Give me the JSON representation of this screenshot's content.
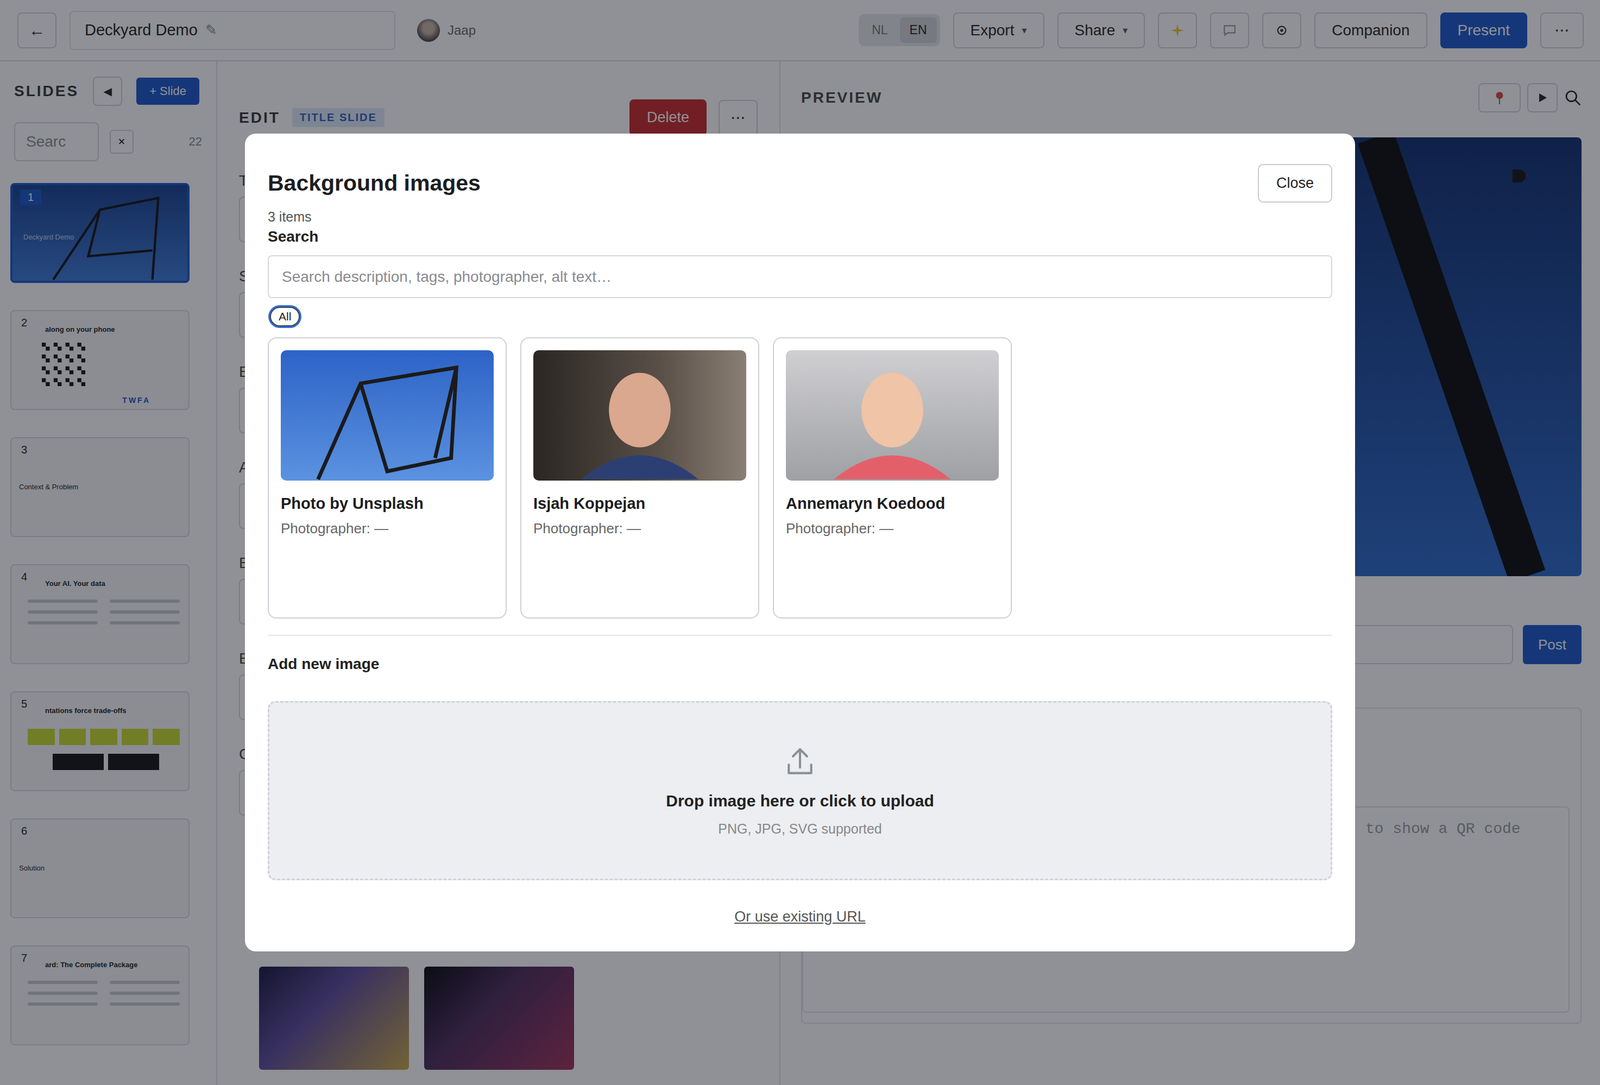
{
  "topbar": {
    "back": "←",
    "title": "Deckyard Demo",
    "rename": "✎",
    "user": "Jaap",
    "languages": [
      {
        "label": "NL",
        "selected": false
      },
      {
        "label": "EN",
        "selected": true
      }
    ],
    "menus": [
      {
        "label": "Export",
        "caret": "▾"
      },
      {
        "label": "Share",
        "caret": "▾"
      }
    ],
    "companion": "Companion",
    "present": "Present",
    "more": "⋯"
  },
  "sidebar": {
    "title": "SLIDES",
    "collapse": "◀",
    "add": "+ Slide",
    "search": {
      "placeholder": "Searc"
    },
    "clear": "×",
    "count": "22",
    "slides": [
      {
        "number": "1",
        "title": "Deckyard Demo",
        "selected": true,
        "kind": "photo"
      },
      {
        "number": "2",
        "title": "along on your phone",
        "selected": false,
        "kind": "qr",
        "code": "TWFA"
      },
      {
        "number": "3",
        "title": "Context & Problem",
        "selected": false,
        "kind": "section"
      },
      {
        "number": "4",
        "title": "Your AI. Your data",
        "selected": false,
        "kind": "list"
      },
      {
        "number": "5",
        "title": "ntations force trade-offs",
        "selected": false,
        "kind": "grid"
      },
      {
        "number": "6",
        "title": "Solution",
        "selected": false,
        "kind": "section"
      },
      {
        "number": "7",
        "title": "ard: The Complete Package",
        "selected": false,
        "kind": "list"
      }
    ]
  },
  "editor": {
    "title": "EDIT",
    "badge": "TITLE SLIDE",
    "delete": "Delete",
    "more": "⋯",
    "field_labels": [
      "T",
      "S",
      "B",
      "A",
      "B",
      "B",
      "C"
    ]
  },
  "preview": {
    "title": "PREVIEW",
    "post": "Post",
    "notes_placeholder": "to show a QR code"
  },
  "modal": {
    "title": "Background images",
    "close": "Close",
    "count": "3 items",
    "search_label": "Search",
    "search_placeholder": "Search description, tags, photographer, alt text…",
    "filters": [
      {
        "label": "All",
        "selected": true
      }
    ],
    "images": [
      {
        "title": "Photo by Unsplash",
        "photographer": "Photographer: —"
      },
      {
        "title": "Isjah Koppejan",
        "photographer": "Photographer: —"
      },
      {
        "title": "Annemaryn Koedood",
        "photographer": "Photographer: —"
      }
    ],
    "upload": {
      "heading": "Add new image",
      "prompt": "Drop image here or click to upload",
      "formats": "PNG, JPG, SVG supported",
      "url_link": "Or use existing URL"
    }
  }
}
